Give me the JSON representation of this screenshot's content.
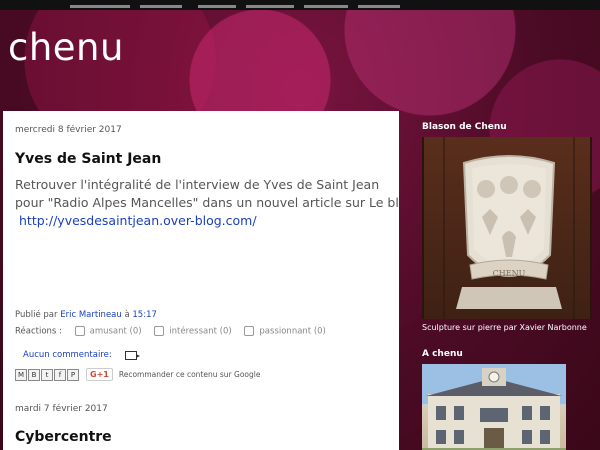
{
  "blog": {
    "title": "chenu"
  },
  "posts": [
    {
      "date": "mercredi 8 février 2017",
      "title": "Yves de Saint Jean",
      "body_line1": "Retrouver l'intégralité de l'interview de Yves de Saint Jean",
      "body_line2": " pour \"Radio Alpes Mancelles\" dans un nouvel article sur  Le blog",
      "body_link": "http://yvesdesaintjean.over-blog.com/",
      "published_by_label": "Publié par",
      "author": "Eric Martineau",
      "at_label": "à",
      "time": "15:17",
      "reactions_label": "Réactions :",
      "reactions": [
        "amusant (0)",
        "intéressant (0)",
        "passionnant (0)"
      ],
      "comments_label": "Aucun commentaire:",
      "share_icons": [
        "M",
        "B",
        "t",
        "f",
        "P"
      ],
      "gplus_label": "G+1",
      "recommend_text": "Recommander ce contenu sur Google"
    },
    {
      "date": "mardi 7 février 2017",
      "title": "Cybercentre"
    }
  ],
  "sidebar": {
    "blason_title": "Blason de Chenu",
    "blason_caption": "Sculpture sur pierre par Xavier Narbonne",
    "blason_shield_text": "CHENU",
    "achenu_title": "A chenu"
  },
  "colors": {
    "background": "#4a0a22",
    "link": "#1a3fbf",
    "post_bg": "#ffffff"
  },
  "icons": [
    "email-post-icon",
    "email-share-icon",
    "blog-this-icon",
    "twitter-share-icon",
    "facebook-share-icon",
    "pinterest-share-icon",
    "gplus-icon"
  ]
}
